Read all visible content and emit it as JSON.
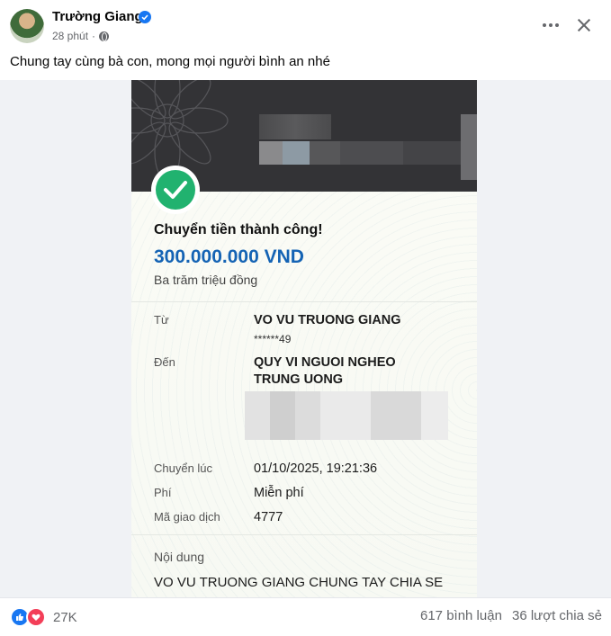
{
  "post": {
    "author": "Trường Giang",
    "time": "28 phút",
    "dot": "·",
    "caption": "Chung tay cùng bà con, mong mọi người bình an nhé"
  },
  "receipt": {
    "title": "Chuyển tiền thành công!",
    "amount": "300.000.000 VND",
    "amount_words": "Ba trăm triệu đồng",
    "from_label": "Từ",
    "from_name": "VO VU TRUONG GIANG",
    "from_account": "******49",
    "to_label": "Đến",
    "to_name_line1": "QUY VI NGUOI NGHEO",
    "to_name_line2": "TRUNG UONG",
    "time_label": "Chuyển lúc",
    "time_value": "01/10/2025, 19:21:36",
    "fee_label": "Phí",
    "fee_value": "Miễn phí",
    "txn_label": "Mã giao dịch",
    "txn_value": "4777",
    "content_label": "Nội dung",
    "content_value": "VO VU TRUONG GIANG CHUNG TAY CHIA SE CUNG BA CON SAU BAO SO"
  },
  "footer": {
    "reaction_count": "27K",
    "comments": "617 bình luận",
    "shares": "36 lượt chia sẻ"
  },
  "colors": {
    "amount_blue": "#1463b4",
    "success_green": "#21b26f",
    "like_blue": "#1877f2",
    "love_red": "#f33e58"
  },
  "icons": [
    "verified-badge-icon",
    "globe-icon",
    "more-icon",
    "close-icon",
    "check-icon",
    "like-icon",
    "love-icon"
  ]
}
